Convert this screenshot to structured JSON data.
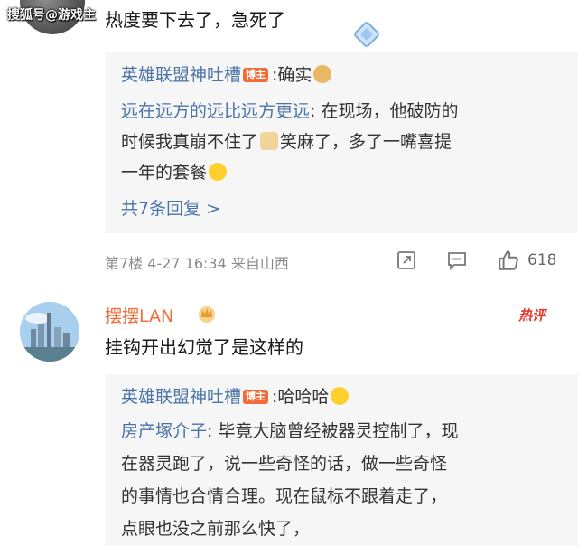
{
  "watermark": "搜狐号@游戏主",
  "comment_top": {
    "text": "热度要下去了，急死了",
    "replies": [
      {
        "author": "英雄联盟神吐槽",
        "badge": "博主",
        "text": ":确实",
        "emoji": "dog-emoji"
      },
      {
        "author": "远在远方的远比远方更远",
        "text_lines": [
          ": 在现场，他破防的",
          "时候我真崩不住了",
          "笑麻了，多了一嘴喜提",
          "一年的套餐"
        ]
      }
    ],
    "more_replies": "共7条回复 >",
    "meta": {
      "floor": "第7楼",
      "date": "4-27 16:34",
      "source": "来自山西"
    },
    "like_count": "618"
  },
  "comment_second": {
    "username": "摆摆LAN",
    "hot_label": "热评",
    "text": "挂钩开出幻觉了是这样的",
    "replies": [
      {
        "author": "英雄联盟神吐槽",
        "badge": "博主",
        "text": ":哈哈哈"
      },
      {
        "author": "房产塚介子",
        "text_lines": [
          ": 毕竟大脑曾经被器灵控制了，现",
          "在器灵跑了，说一些奇怪的话，做一些奇怪",
          "的事情也合情合理。现在鼠标不跟着走了，",
          "点眼也没之前那么快了，"
        ]
      }
    ]
  },
  "colors": {
    "link_blue": "#4a74a8",
    "badge_orange": "#f26c3a",
    "hot_red": "#e23a2e",
    "reply_bg": "#f6f6f6"
  }
}
